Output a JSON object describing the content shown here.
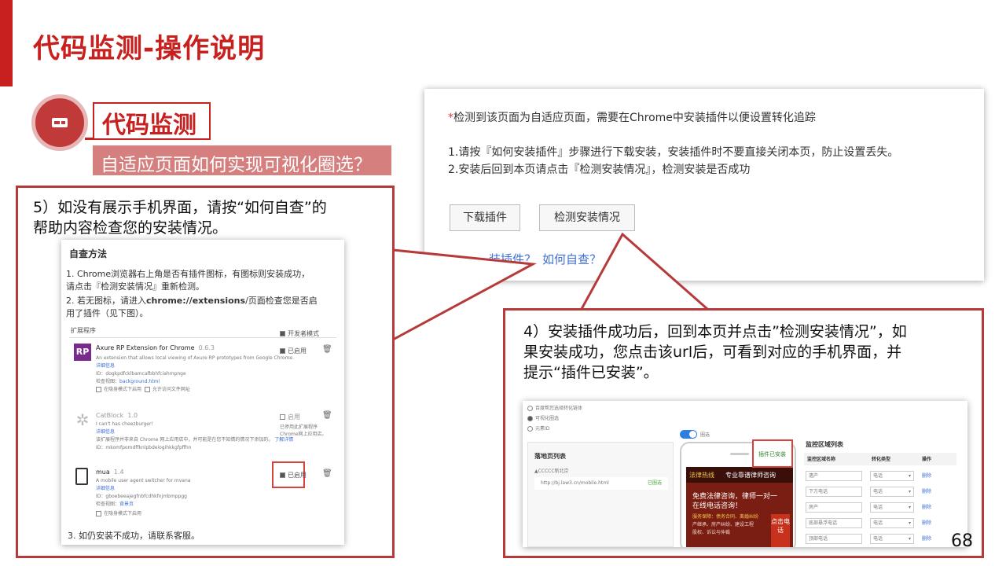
{
  "slide": {
    "title": "代码监测-操作说明",
    "section_title": "代码监测",
    "subtitle": "自适应页面如何实现可视化圈选？",
    "page_number": "68"
  },
  "callout_left": {
    "line1": "5）如没有展示手机界面，请按“如何自查”的",
    "line2": "帮助内容检查您的安装情况。"
  },
  "callout_right": {
    "line1": "4）安装插件成功后，回到本页并点击”检测安装情况”，如",
    "line2": "果安装成功，您点击该url后，可看到对应的手机界面，并",
    "line3": "提示“插件已安装”。"
  },
  "top_panel": {
    "notice": "检测到该页面为自适应页面，需要在Chrome中安装插件以便设置转化追踪",
    "step1": "1.请按『如何安装插件』步骤进行下载安装，安装插件时不要直接关闭本页，防止设置丢失。",
    "step2": "2.安装后回到本页请点击『检测安装情况』，检测安装是否成功",
    "download_button": "下载插件",
    "check_button": "检测安装情况",
    "link_partial": "装插件？",
    "link_self_check": "如何自查？"
  },
  "self_check_panel": {
    "title": "自查方法",
    "item1_line1": "1. Chrome浏览器右上角是否有插件图标，有图标则安装成功，",
    "item1_line2": "请点击『检测安装情况』重新检测。",
    "item2_line1_a": "2. 若无图标，请进入",
    "item2_line1_b": "chrome://extensions",
    "item2_line1_c": "/页面检查您是否启",
    "item2_line2": "用了插件（见下图）。",
    "item3": "3. 如仍安装不成功，请联系客服。",
    "extensions_header": "扩展程序",
    "dev_mode": "开发者模式",
    "extensions": [
      {
        "name": "Axure RP Extension for Chrome",
        "version": "0.6.3",
        "desc": "An extension that allows local viewing of Axure RP prototypes from Google Chrome.",
        "details": "详细信息",
        "id": "ID：dogkpdfcklbamcafbbhfciahmpnge",
        "view": "检查视图：",
        "view_link": "background.html",
        "opt1": "在隐身模式下启用",
        "opt2": "允许访问文件网址",
        "enabled": "已启用"
      },
      {
        "name": "CatBlock",
        "version": "1.0",
        "desc": "I can't has cheezburger!",
        "details": "详细信息",
        "note": "该扩展程序并非来自 Chrome 网上应用店中，并可能是在您不知情的情况下添加的。",
        "note_link": "了解详情",
        "id": "ID：mkomfpomdffknlpbdeiogihkkgfpffhn",
        "enabled": "启用",
        "disabled_note": "已停用此扩展程序Chrome网上应用店。"
      },
      {
        "name": "mua",
        "version": "1.4",
        "desc": "A mobile user agent switcher for mvana",
        "details": "详细信息",
        "id": "ID：gboebeeajegfnbfcdhkfnjmbmppgg",
        "view": "检查视图：",
        "view_link": "背景页",
        "opt1": "在隐身模式下启用",
        "enabled": "已启用"
      }
    ]
  },
  "mobile_panel": {
    "radio1": "百度帮您选择转化链体",
    "radio2": "可视化圈选",
    "radio3": "元素ID",
    "toggle_label": "圈选",
    "page_list_title": "落地页列表",
    "tree_item": "▲CCCCC新北京",
    "url": "http://bj.law3.cn/mobile.html",
    "url_status": "已圈选",
    "plugin_installed": "插件已安装",
    "banner_left": "法律热线",
    "banner_right": "专业靠谱律师咨询",
    "promo_line1": "免费法律咨询，律师一对一",
    "promo_line2": "在线电话咨询！",
    "promo_small1": "服务保障：债务合同、离婚纠纷",
    "promo_small2": "产继承、房产纠纷、建设工程",
    "promo_small3": "股权、诉讼与仲裁",
    "promo_button": "点击电话",
    "table_title": "监控区域列表",
    "col1": "监控区域名称",
    "col2": "转化类型",
    "col3": "操作",
    "rows": [
      {
        "name": "遗产",
        "type": "电话",
        "op": "删除"
      },
      {
        "name": "下方电话",
        "type": "电话",
        "op": "删除"
      },
      {
        "name": "房产",
        "type": "电话",
        "op": "删除"
      },
      {
        "name": "底部悬浮电话",
        "type": "电话",
        "op": "删除"
      },
      {
        "name": "顶部电话",
        "type": "电话",
        "op": "删除"
      }
    ]
  }
}
